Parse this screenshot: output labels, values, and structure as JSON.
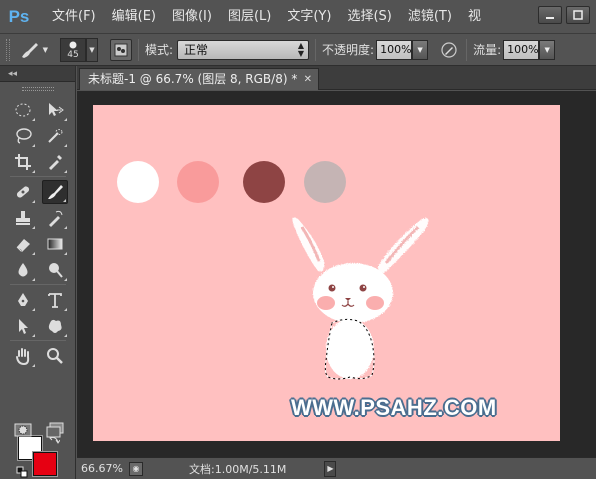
{
  "app": {
    "logo": "Ps"
  },
  "menu": {
    "items": [
      "文件(F)",
      "编辑(E)",
      "图像(I)",
      "图层(L)",
      "文字(Y)",
      "选择(S)",
      "滤镜(T)",
      "视"
    ]
  },
  "options": {
    "brush_size": "45",
    "mode_label": "模式:",
    "mode_value": "正常",
    "opacity_label": "不透明度:",
    "opacity_value": "100%",
    "flow_label": "流量:",
    "flow_value": "100%"
  },
  "document": {
    "tab_title": "未标题-1 @ 66.7% (图层 8, RGB/8) *",
    "watermark": "WWW.PSAHZ.COM"
  },
  "colors": {
    "foreground": "#ffffff",
    "background": "#e60012",
    "canvas": "#ffc0c0",
    "swatches": [
      "#ffffff",
      "#f99b9b",
      "#8e4444",
      "#c5b4b4"
    ]
  },
  "status": {
    "zoom": "66.67%",
    "doc_info": "文档:1.00M/5.11M"
  }
}
